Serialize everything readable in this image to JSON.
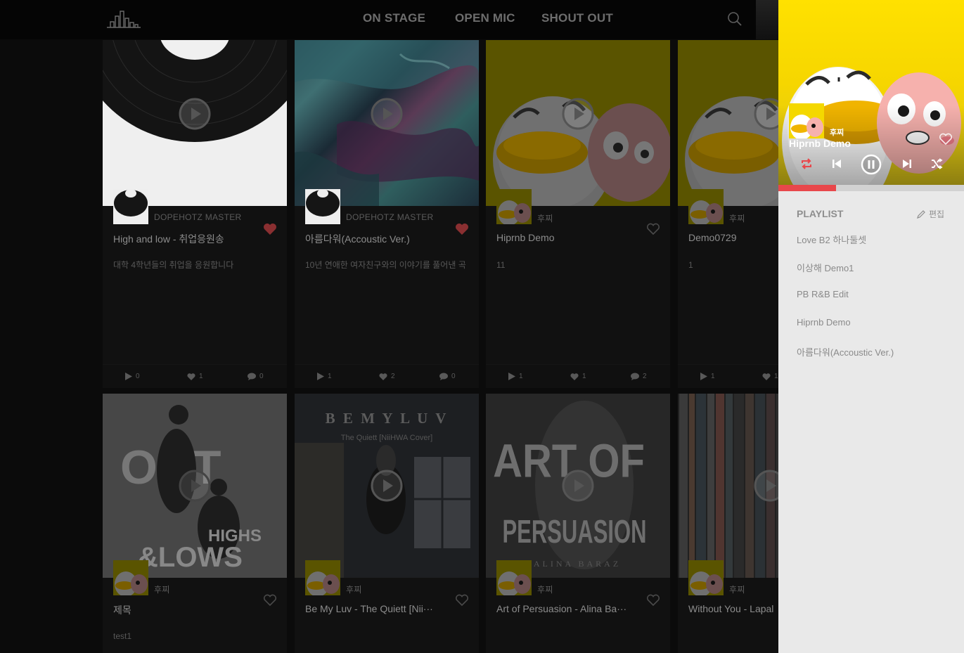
{
  "nav": {
    "items": [
      "ON STAGE",
      "OPEN MIC",
      "SHOUT OUT"
    ]
  },
  "cards": [
    {
      "artist": "DOPEHOTZ MASTER",
      "title": "High and low - 취업응원송",
      "desc": "대학 4학년들의 취업을 응원합니다",
      "plays": "0",
      "likes": "1",
      "comments": "0",
      "liked": true,
      "cover": "vinyl-record"
    },
    {
      "artist": "DOPEHOTZ MASTER",
      "title": "아름다워(Accoustic Ver.)",
      "desc": "10년 연애한 여자친구와의 이야기를 풀어낸 곡",
      "plays": "1",
      "likes": "2",
      "comments": "0",
      "liked": true,
      "cover": "fluid-art"
    },
    {
      "artist": "후찌",
      "title": "Hiprnb Demo",
      "desc": "11",
      "plays": "1",
      "likes": "1",
      "comments": "2",
      "liked": false,
      "cover": "cartoon-characters"
    },
    {
      "artist": "후찌",
      "title": "Demo0729",
      "desc": "1",
      "plays": "1",
      "likes": "1",
      "comments": "",
      "liked": false,
      "cover": "cartoon-characters"
    },
    {
      "artist": "후찌",
      "title": "제목",
      "desc": "test1",
      "liked": false,
      "cover": "oct-highs-lows"
    },
    {
      "artist": "후찌",
      "title": "Be My Luv - The Quiett [Nii···",
      "desc": "",
      "liked": false,
      "cover": "be-my-luv"
    },
    {
      "artist": "후찌",
      "title": "Art of Persuasion - Alina Ba···",
      "desc": "",
      "liked": false,
      "cover": "art-of-persuasion"
    },
    {
      "artist": "후찌",
      "title": "Without You - Lapal",
      "desc": "",
      "liked": false,
      "cover": "collage"
    }
  ],
  "covers": {
    "oct_top": "OCT",
    "oct_bottom1": "HIGHS",
    "oct_bottom2": "&LOWS",
    "bml_title": "B E   M Y   L U V",
    "bml_sub": "The Quiett [NiiHWA Cover]",
    "aop_line1": "ART OF",
    "aop_line2": "PERSUASION",
    "aop_artist": "ALINA BARAZ"
  },
  "player": {
    "artist": "후찌",
    "title": "Hiprnb Demo",
    "progress": 0.31,
    "state": "playing"
  },
  "playlist": {
    "header": "PLAYLIST",
    "edit_label": "편집",
    "items": [
      "Love B2 하나둘셋",
      "이상해 Demo1",
      "PB R&B Edit",
      "Hiprnb Demo",
      "아름다워(Accoustic Ver.)"
    ]
  },
  "colors": {
    "accent_red": "#e8474b",
    "brand_yellow": "#ffe100"
  }
}
